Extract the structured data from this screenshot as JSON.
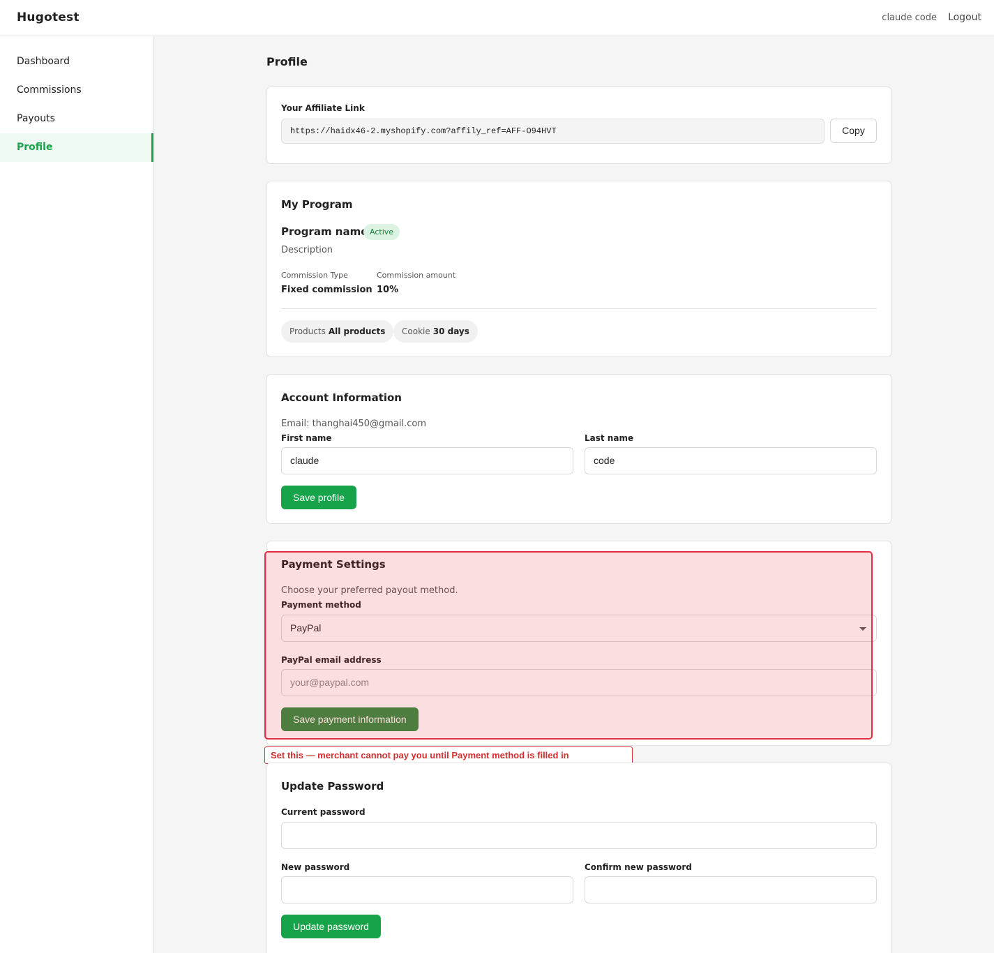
{
  "app": {
    "brand": "Hugotest"
  },
  "header": {
    "user_name": "claude code",
    "logout_label": "Logout"
  },
  "sidebar": {
    "items": [
      {
        "label": "Dashboard"
      },
      {
        "label": "Commissions"
      },
      {
        "label": "Payouts"
      },
      {
        "label": "Profile",
        "active": true
      }
    ]
  },
  "page": {
    "title": "Profile"
  },
  "affiliate": {
    "label": "Your Affiliate Link",
    "url": "https://haidx46-2.myshopify.com?affily_ref=AFF-O94HVT",
    "copy_label": "Copy"
  },
  "program": {
    "title": "My Program",
    "name": "Program name",
    "status": "Active",
    "description": "Description",
    "commission_type_label": "Commission Type",
    "commission_type_value": "Fixed commission",
    "commission_amount_label": "Commission amount",
    "commission_amount_value": "10%",
    "products_label": "Products",
    "products_value": "All products",
    "cookie_label": "Cookie",
    "cookie_value": "30 days"
  },
  "account": {
    "title": "Account Information",
    "email_line": "Email: thanghai450@gmail.com",
    "first_name_label": "First name",
    "first_name_value": "claude",
    "last_name_label": "Last name",
    "last_name_value": "code",
    "save_label": "Save profile"
  },
  "payment": {
    "title": "Payment Settings",
    "description": "Choose your preferred payout method.",
    "method_label": "Payment method",
    "method_value": "PayPal",
    "paypal_email_label": "PayPal email address",
    "paypal_email_placeholder": "your@paypal.com",
    "save_label": "Save payment information"
  },
  "annotation": {
    "text": "Set this — merchant cannot pay you until Payment method is filled in",
    "color": "#e0303f"
  },
  "password": {
    "title": "Update Password",
    "current_label": "Current password",
    "new_label": "New password",
    "confirm_label": "Confirm new password",
    "submit_label": "Update password"
  },
  "colors": {
    "accent": "#16a34a",
    "badge_bg": "#dcf3e3"
  }
}
